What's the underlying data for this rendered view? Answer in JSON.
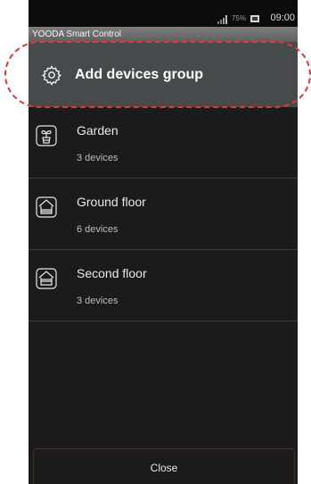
{
  "status": {
    "battery_percent": "75%",
    "time": "09:00",
    "signal_icon": "signal-icon",
    "battery_icon": "battery-icon"
  },
  "app": {
    "title": "YOODA Smart Control"
  },
  "add_group": {
    "label": "Add devices group",
    "icon": "gear-icon"
  },
  "groups": [
    {
      "name": "Garden",
      "count": "3 devices",
      "icon": "plant-pot-icon"
    },
    {
      "name": "Ground floor",
      "count": "6 devices",
      "icon": "house-icon"
    },
    {
      "name": "Second floor",
      "count": "3 devices",
      "icon": "house-icon"
    }
  ],
  "footer": {
    "close_label": "Close"
  },
  "colors": {
    "accent_dashed": "#e8333b",
    "background": "#1b1b1b",
    "header_bg": "#474a4a"
  }
}
